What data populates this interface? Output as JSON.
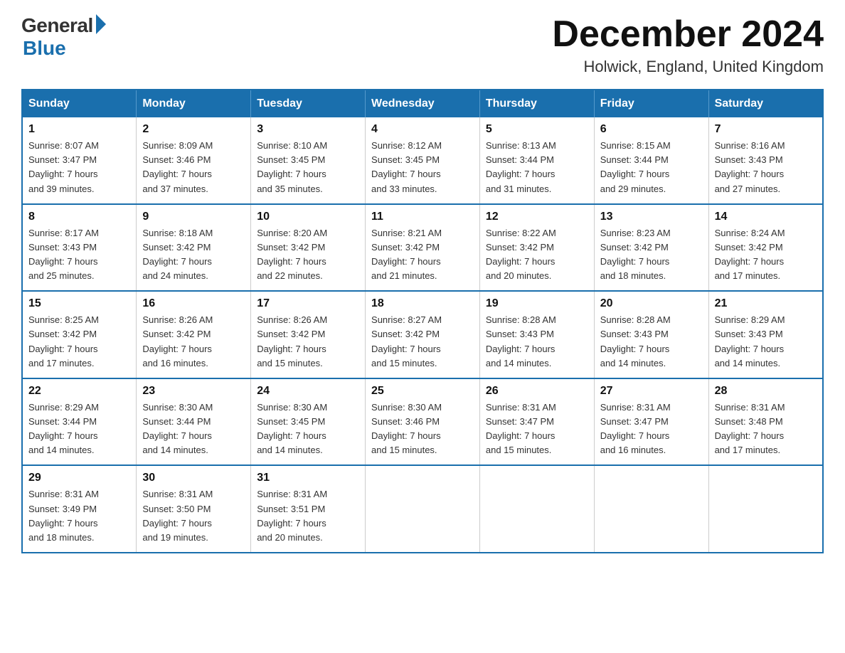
{
  "header": {
    "logo_general": "General",
    "logo_blue": "Blue",
    "title": "December 2024",
    "location": "Holwick, England, United Kingdom"
  },
  "days_of_week": [
    "Sunday",
    "Monday",
    "Tuesday",
    "Wednesday",
    "Thursday",
    "Friday",
    "Saturday"
  ],
  "weeks": [
    [
      {
        "day": "1",
        "sunrise": "8:07 AM",
        "sunset": "3:47 PM",
        "daylight": "7 hours and 39 minutes."
      },
      {
        "day": "2",
        "sunrise": "8:09 AM",
        "sunset": "3:46 PM",
        "daylight": "7 hours and 37 minutes."
      },
      {
        "day": "3",
        "sunrise": "8:10 AM",
        "sunset": "3:45 PM",
        "daylight": "7 hours and 35 minutes."
      },
      {
        "day": "4",
        "sunrise": "8:12 AM",
        "sunset": "3:45 PM",
        "daylight": "7 hours and 33 minutes."
      },
      {
        "day": "5",
        "sunrise": "8:13 AM",
        "sunset": "3:44 PM",
        "daylight": "7 hours and 31 minutes."
      },
      {
        "day": "6",
        "sunrise": "8:15 AM",
        "sunset": "3:44 PM",
        "daylight": "7 hours and 29 minutes."
      },
      {
        "day": "7",
        "sunrise": "8:16 AM",
        "sunset": "3:43 PM",
        "daylight": "7 hours and 27 minutes."
      }
    ],
    [
      {
        "day": "8",
        "sunrise": "8:17 AM",
        "sunset": "3:43 PM",
        "daylight": "7 hours and 25 minutes."
      },
      {
        "day": "9",
        "sunrise": "8:18 AM",
        "sunset": "3:42 PM",
        "daylight": "7 hours and 24 minutes."
      },
      {
        "day": "10",
        "sunrise": "8:20 AM",
        "sunset": "3:42 PM",
        "daylight": "7 hours and 22 minutes."
      },
      {
        "day": "11",
        "sunrise": "8:21 AM",
        "sunset": "3:42 PM",
        "daylight": "7 hours and 21 minutes."
      },
      {
        "day": "12",
        "sunrise": "8:22 AM",
        "sunset": "3:42 PM",
        "daylight": "7 hours and 20 minutes."
      },
      {
        "day": "13",
        "sunrise": "8:23 AM",
        "sunset": "3:42 PM",
        "daylight": "7 hours and 18 minutes."
      },
      {
        "day": "14",
        "sunrise": "8:24 AM",
        "sunset": "3:42 PM",
        "daylight": "7 hours and 17 minutes."
      }
    ],
    [
      {
        "day": "15",
        "sunrise": "8:25 AM",
        "sunset": "3:42 PM",
        "daylight": "7 hours and 17 minutes."
      },
      {
        "day": "16",
        "sunrise": "8:26 AM",
        "sunset": "3:42 PM",
        "daylight": "7 hours and 16 minutes."
      },
      {
        "day": "17",
        "sunrise": "8:26 AM",
        "sunset": "3:42 PM",
        "daylight": "7 hours and 15 minutes."
      },
      {
        "day": "18",
        "sunrise": "8:27 AM",
        "sunset": "3:42 PM",
        "daylight": "7 hours and 15 minutes."
      },
      {
        "day": "19",
        "sunrise": "8:28 AM",
        "sunset": "3:43 PM",
        "daylight": "7 hours and 14 minutes."
      },
      {
        "day": "20",
        "sunrise": "8:28 AM",
        "sunset": "3:43 PM",
        "daylight": "7 hours and 14 minutes."
      },
      {
        "day": "21",
        "sunrise": "8:29 AM",
        "sunset": "3:43 PM",
        "daylight": "7 hours and 14 minutes."
      }
    ],
    [
      {
        "day": "22",
        "sunrise": "8:29 AM",
        "sunset": "3:44 PM",
        "daylight": "7 hours and 14 minutes."
      },
      {
        "day": "23",
        "sunrise": "8:30 AM",
        "sunset": "3:44 PM",
        "daylight": "7 hours and 14 minutes."
      },
      {
        "day": "24",
        "sunrise": "8:30 AM",
        "sunset": "3:45 PM",
        "daylight": "7 hours and 14 minutes."
      },
      {
        "day": "25",
        "sunrise": "8:30 AM",
        "sunset": "3:46 PM",
        "daylight": "7 hours and 15 minutes."
      },
      {
        "day": "26",
        "sunrise": "8:31 AM",
        "sunset": "3:47 PM",
        "daylight": "7 hours and 15 minutes."
      },
      {
        "day": "27",
        "sunrise": "8:31 AM",
        "sunset": "3:47 PM",
        "daylight": "7 hours and 16 minutes."
      },
      {
        "day": "28",
        "sunrise": "8:31 AM",
        "sunset": "3:48 PM",
        "daylight": "7 hours and 17 minutes."
      }
    ],
    [
      {
        "day": "29",
        "sunrise": "8:31 AM",
        "sunset": "3:49 PM",
        "daylight": "7 hours and 18 minutes."
      },
      {
        "day": "30",
        "sunrise": "8:31 AM",
        "sunset": "3:50 PM",
        "daylight": "7 hours and 19 minutes."
      },
      {
        "day": "31",
        "sunrise": "8:31 AM",
        "sunset": "3:51 PM",
        "daylight": "7 hours and 20 minutes."
      },
      null,
      null,
      null,
      null
    ]
  ],
  "labels": {
    "sunrise": "Sunrise: ",
    "sunset": "Sunset: ",
    "daylight": "Daylight: "
  }
}
